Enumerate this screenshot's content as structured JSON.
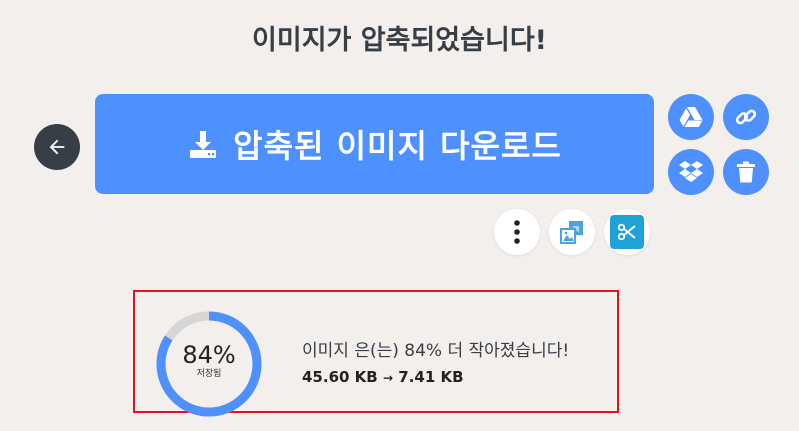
{
  "title": "이미지가 압축되었습니다!",
  "download": {
    "label": "압축된 이미지 다운로드"
  },
  "actions": {
    "google_drive": "google-drive-icon",
    "link": "link-icon",
    "dropbox": "dropbox-icon",
    "delete": "trash-icon",
    "more": "more-vertical-icon",
    "resize": "resize-image-icon",
    "crop": "scissors-icon"
  },
  "result": {
    "percent_label": "84%",
    "percent_value": 84,
    "saved_label": "저장됨",
    "message": "이미지 은(는) 84% 더 작아졌습니다!",
    "original_size": "45.60 KB",
    "arrow": "→",
    "compressed_size": "7.41 KB"
  },
  "colors": {
    "background": "#f2efec",
    "primary": "#4d90fe",
    "dark": "#383e45",
    "ring_track": "#d6d6d6",
    "highlight_border": "#e0141b",
    "crop_button": "#1fa3d6"
  }
}
